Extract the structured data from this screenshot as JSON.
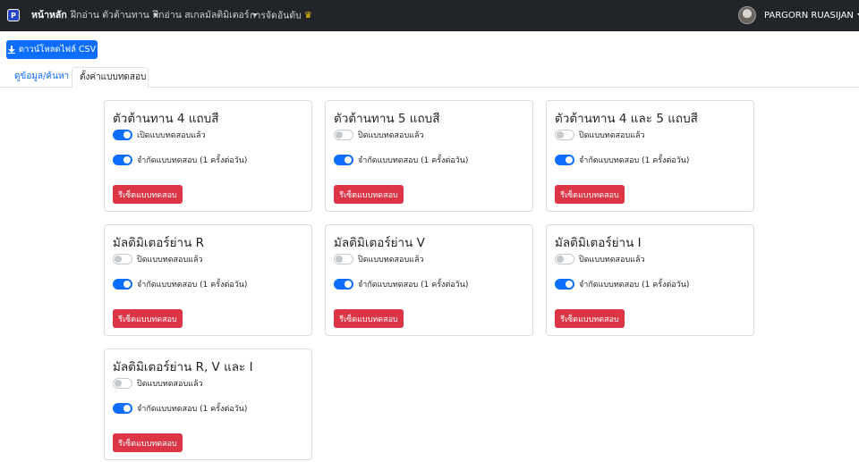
{
  "navbar": {
    "brand_glyph": "P",
    "home": "หน้าหลัก",
    "menu1": "ฝึกอ่าน ตัวต้านทาน",
    "menu2": "ฝึกอ่าน สเกลมัลติมิเตอร์",
    "menu3": "การจัดอันดับ",
    "crown_icon": "crown-icon",
    "crown_glyph": "♛",
    "user": "PARGORN RUASIJAN"
  },
  "download_label": "ดาวน์โหลดไฟล์ CSV",
  "tabs": [
    "ดูข้อมูล/ค้นหา",
    "ตั้งค่าแบบทดสอบ"
  ],
  "colors": {
    "primary": "#0d6efd",
    "danger": "#dc3545",
    "navbar": "#212529"
  },
  "cards": [
    {
      "title": "ตัวต้านทาน 4 แถบสี",
      "toggle1_on": true,
      "toggle1_label": "เปิดแบบทดสอบแล้ว",
      "toggle2_on": true,
      "toggle2_label": "จำกัดแบบทดสอบ (1 ครั้งต่อวัน)",
      "reset": "รีเซ็ตแบบทดสอบ"
    },
    {
      "title": "ตัวต้านทาน 5 แถบสี",
      "toggle1_on": false,
      "toggle1_label": "ปิดแบบทดสอบแล้ว",
      "toggle2_on": true,
      "toggle2_label": "จำกัดแบบทดสอบ (1 ครั้งต่อวัน)",
      "reset": "รีเซ็ตแบบทดสอบ"
    },
    {
      "title": "ตัวต้านทาน 4 และ 5 แถบสี",
      "toggle1_on": false,
      "toggle1_label": "ปิดแบบทดสอบแล้ว",
      "toggle2_on": true,
      "toggle2_label": "จำกัดแบบทดสอบ (1 ครั้งต่อวัน)",
      "reset": "รีเซ็ตแบบทดสอบ"
    },
    {
      "title": "มัลติมิเตอร์ย่าน R",
      "toggle1_on": false,
      "toggle1_label": "ปิดแบบทดสอบแล้ว",
      "toggle2_on": true,
      "toggle2_label": "จำกัดแบบทดสอบ (1 ครั้งต่อวัน)",
      "reset": "รีเซ็ตแบบทดสอบ"
    },
    {
      "title": "มัลติมิเตอร์ย่าน V",
      "toggle1_on": false,
      "toggle1_label": "ปิดแบบทดสอบแล้ว",
      "toggle2_on": true,
      "toggle2_label": "จำกัดแบบทดสอบ (1 ครั้งต่อวัน)",
      "reset": "รีเซ็ตแบบทดสอบ"
    },
    {
      "title": "มัลติมิเตอร์ย่าน I",
      "toggle1_on": false,
      "toggle1_label": "ปิดแบบทดสอบแล้ว",
      "toggle2_on": true,
      "toggle2_label": "จำกัดแบบทดสอบ (1 ครั้งต่อวัน)",
      "reset": "รีเซ็ตแบบทดสอบ"
    },
    {
      "title": "มัลติมิเตอร์ย่าน R, V และ I",
      "toggle1_on": false,
      "toggle1_label": "ปิดแบบทดสอบแล้ว",
      "toggle2_on": true,
      "toggle2_label": "จำกัดแบบทดสอบ (1 ครั้งต่อวัน)",
      "reset": "รีเซ็ตแบบทดสอบ"
    }
  ]
}
